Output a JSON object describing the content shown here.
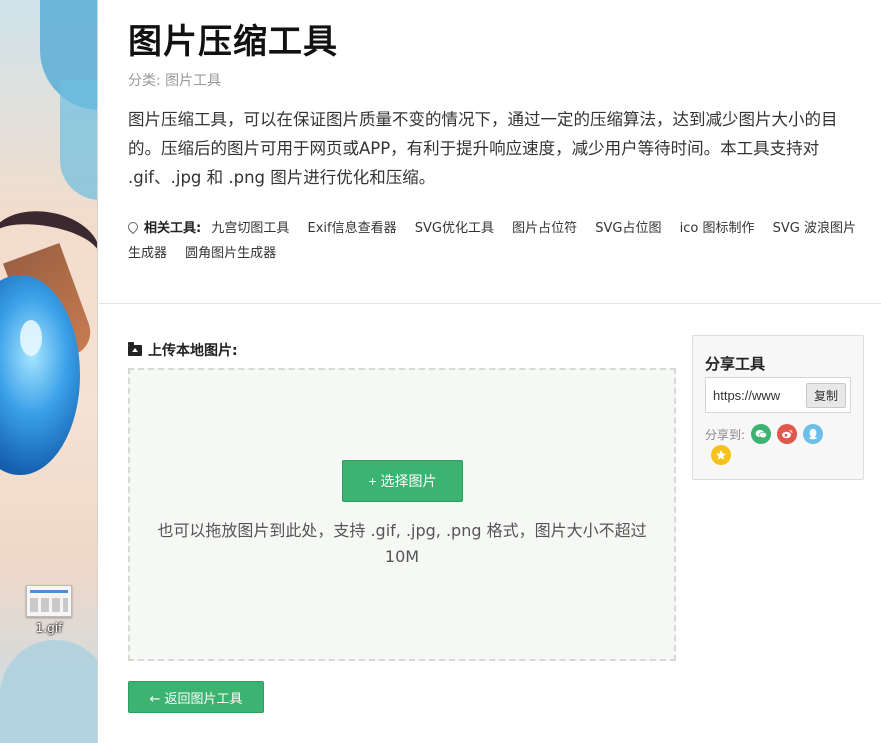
{
  "desktop": {
    "file_icon_label": "1.gif"
  },
  "header": {
    "title": "图片压缩工具",
    "category_prefix": "分类:",
    "category_link": "图片工具"
  },
  "description": "图片压缩工具，可以在保证图片质量不变的情况下，通过一定的压缩算法，达到减少图片大小的目的。压缩后的图片可用于网页或APP，有利于提升响应速度，减少用户等待时间。本工具支持对 .gif、.jpg 和 .png 图片进行优化和压缩。",
  "related": {
    "label": "相关工具:",
    "links": [
      "九宫切图工具",
      "Exif信息查看器",
      "SVG优化工具",
      "图片占位符",
      "SVG占位图",
      "ico 图标制作",
      "SVG 波浪图片生成器",
      "圆角图片生成器"
    ]
  },
  "upload": {
    "heading": "上传本地图片:",
    "choose_button": "+ 选择图片",
    "hint": "也可以拖放图片到此处，支持 .gif, .jpg, .png 格式，图片大小不超过 10M"
  },
  "back_button": "← 返回图片工具",
  "share": {
    "title": "分享工具",
    "url_value": "https://www",
    "copy_label": "复制",
    "share_to_label": "分享到:",
    "icons": [
      "wechat-icon",
      "weibo-icon",
      "qq-icon",
      "qzone-icon"
    ]
  },
  "colors": {
    "accent_green": "#3cb371",
    "weibo_red": "#e0584a",
    "qq_blue": "#6cbfe8",
    "qzone_yellow": "#f4c21a"
  }
}
